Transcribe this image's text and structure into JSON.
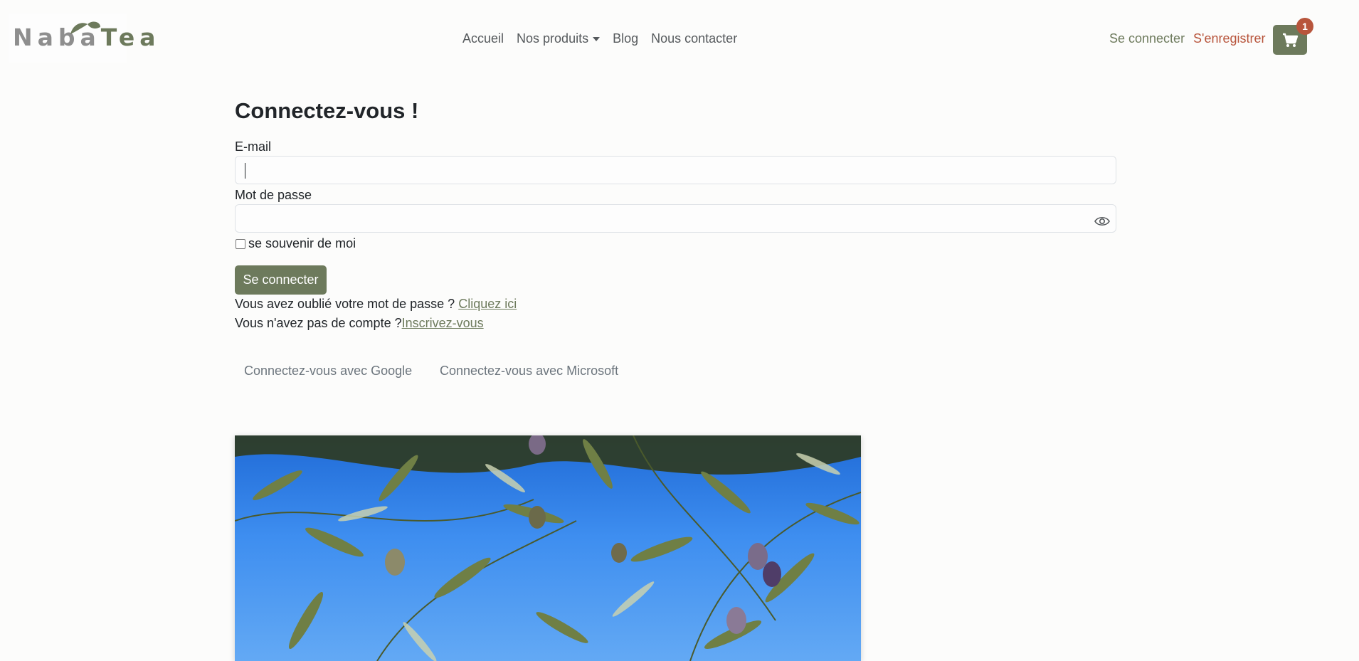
{
  "brand": {
    "logo_text_a": "Naba",
    "logo_text_b": "Tea"
  },
  "nav": {
    "home": "Accueil",
    "products": "Nos produits",
    "blog": "Blog",
    "contact": "Nous contacter",
    "login": "Se connecter",
    "register": "S'enregistrer",
    "cart_count": "1"
  },
  "form": {
    "title": "Connectez-vous !",
    "email_label": "E-mail",
    "email_value": "",
    "password_label": "Mot de passe",
    "password_value": "",
    "remember_label": "se souvenir de moi",
    "remember_checked": false,
    "submit_label": "Se connecter",
    "forgot_text": "Vous avez oublié votre mot de passe ? ",
    "forgot_link": "Cliquez ici",
    "signup_text": "Vous n'avez pas de compte ?",
    "signup_link": "Inscrivez-vous"
  },
  "oauth": {
    "google": "Connectez-vous avec Google",
    "microsoft": "Connectez-vous avec Microsoft"
  },
  "colors": {
    "accent": "#6d7a5c",
    "register": "#b8553c",
    "badge": "#b8553c"
  },
  "icons": {
    "cart": "cart-icon",
    "eye": "eye-icon",
    "caret": "chevron-down-icon"
  }
}
